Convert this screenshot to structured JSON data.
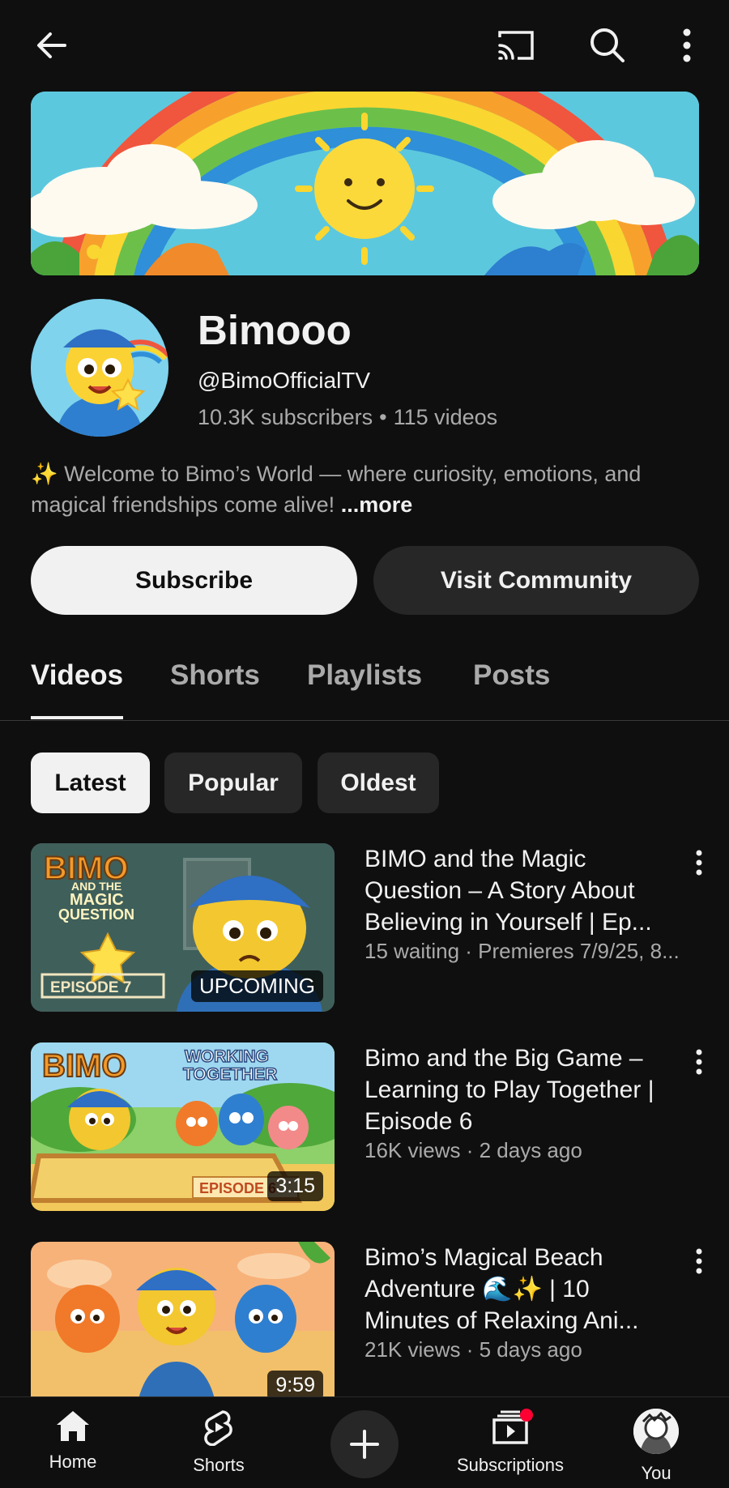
{
  "channel": {
    "name": "Bimooo",
    "handle": "@BimoOfficialTV",
    "subscribers": "10.3K subscribers",
    "videos_count": "115 videos",
    "meta_separator": "•",
    "description": "✨ Welcome to Bimo’s World — where curiosity, emotions, and magical friendships come alive!",
    "more_label": "...more"
  },
  "actions": {
    "subscribe_label": "Subscribe",
    "community_label": "Visit Community"
  },
  "tabs": [
    {
      "label": "Videos",
      "active": true
    },
    {
      "label": "Shorts",
      "active": false
    },
    {
      "label": "Playlists",
      "active": false
    },
    {
      "label": "Posts",
      "active": false
    }
  ],
  "filters": [
    {
      "label": "Latest",
      "active": true
    },
    {
      "label": "Popular",
      "active": false
    },
    {
      "label": "Oldest",
      "active": false
    }
  ],
  "videos": [
    {
      "title": "BIMO and the Magic Question – A Story About Believing in Yourself | Ep...",
      "meta": "15 waiting · Premieres 7/9/25, 8...",
      "badge": "UPCOMING",
      "thumb_title": "BIMO",
      "thumb_subtitle_1": "AND THE",
      "thumb_subtitle_2": "MAGIC",
      "thumb_subtitle_3": "QUESTION",
      "thumb_episode": "EPISODE 7"
    },
    {
      "title": "Bimo and the Big Game – Learning to Play Together | Episode 6",
      "meta": "16K views · 2 days ago",
      "badge": "3:15",
      "thumb_title": "BIMO",
      "thumb_subtitle_1": "WORKING",
      "thumb_subtitle_2": "TOGETHER",
      "thumb_episode": "EPISODE 6"
    },
    {
      "title": "Bimo’s Magical Beach Adventure 🌊✨ | 10 Minutes of Relaxing Ani...",
      "meta": "21K views · 5 days ago",
      "badge": "9:59"
    }
  ],
  "nav": {
    "home": "Home",
    "shorts": "Shorts",
    "subscriptions": "Subscriptions",
    "you": "You"
  },
  "colors": {
    "background": "#0f0f0f",
    "chip_bg": "#272727",
    "text_primary": "#f1f1f1",
    "text_secondary": "#aaaaaa",
    "notification_dot": "#ff0033"
  }
}
